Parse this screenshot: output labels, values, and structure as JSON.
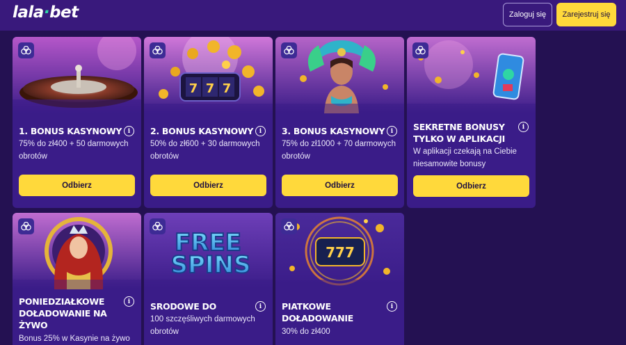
{
  "header": {
    "logo_main": "lala",
    "logo_dot": "·",
    "logo_tail": "bet",
    "login_label": "Zaloguj się",
    "register_label": "Zarejestruj się",
    "accent_color": "#ffd93b",
    "brand_color": "#2fd6a4"
  },
  "offers": [
    {
      "title": "1. BONUS KASYNOWY",
      "description": "75% do zł400 + 50 darmowych obrotów",
      "cta": "Odbierz",
      "info_icon": "info-icon",
      "badge_icon": "gift-chips-icon"
    },
    {
      "title": "2. BONUS KASYNOWY",
      "description": "50% do zł600 + 30 darmowych obrotów",
      "cta": "Odbierz",
      "info_icon": "info-icon",
      "badge_icon": "gift-chips-icon"
    },
    {
      "title": "3. BONUS KASYNOWY",
      "description": "75% do zł1000 + 70 darmowych obrotów",
      "cta": "Odbierz",
      "info_icon": "info-icon",
      "badge_icon": "gift-chips-icon"
    },
    {
      "title": "SEKRETNE BONUSY TYLKO W APLIKACJI",
      "description": "W aplikacji czekają na Ciebie niesamowite bonusy",
      "cta": "Odbierz",
      "info_icon": "info-icon",
      "badge_icon": "gift-chips-icon"
    },
    {
      "title": "PONIEDZIAŁKOWE DOŁADOWANIE NA ŻYWO",
      "description": "Bonus 25% w Kasynie na żywo",
      "info_icon": "info-icon",
      "badge_icon": "gift-chips-icon"
    },
    {
      "title": "SRODOWE DO",
      "description": "100 szczęśliwych darmowych obrotów",
      "info_icon": "info-icon",
      "badge_icon": "gift-chips-icon"
    },
    {
      "title": "PIATKOWE DOŁADOWANIE",
      "description": "30% do zł400",
      "info_icon": "info-icon",
      "badge_icon": "gift-chips-icon"
    }
  ],
  "promo_art": {
    "free_spins_line1": "FREE",
    "free_spins_line2": "SPINS",
    "slot_digits": "777"
  }
}
